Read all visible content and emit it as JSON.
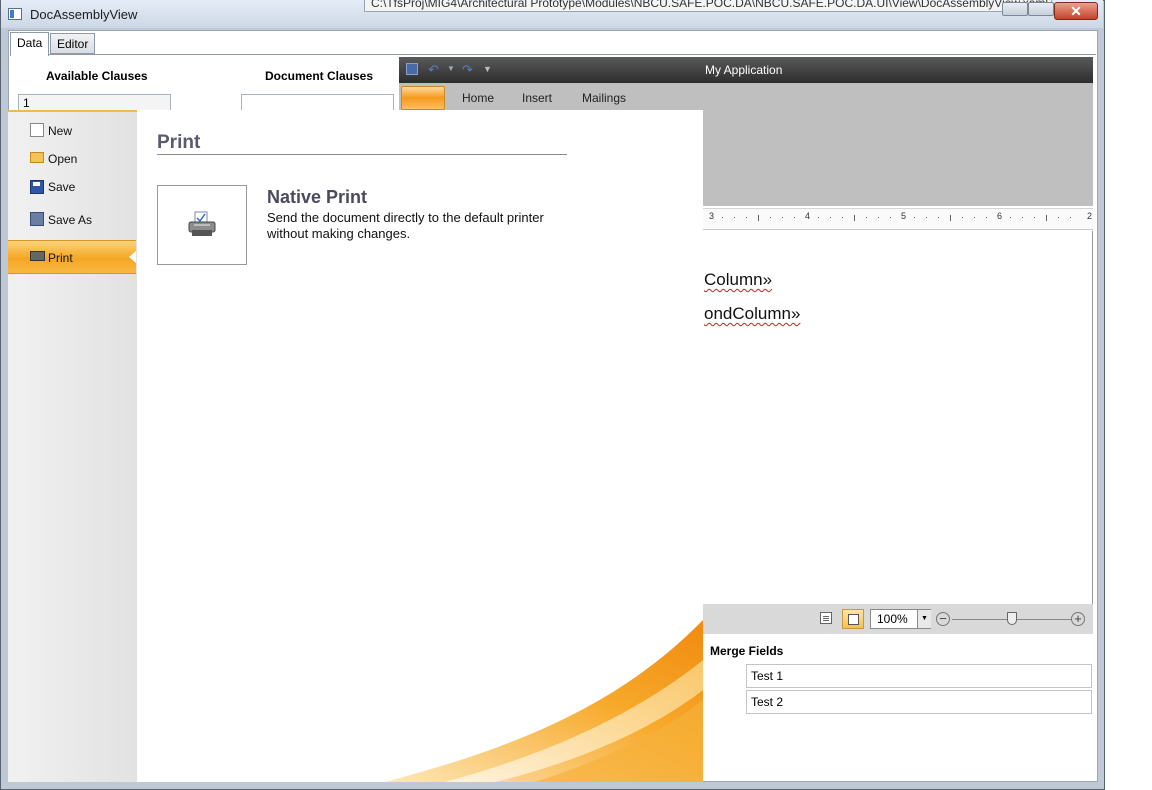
{
  "window": {
    "title": "DocAssemblyView",
    "tooltip_path": "C:\\TfsProj\\MIG4\\Architectural Prototype\\Modules\\NBCU.SAFE.POC.DA\\NBCU.SAFE.POC.DA.UI\\View\\DocAssemblyView.xaml.cs",
    "close_glyph": "✕"
  },
  "tabs": [
    {
      "label": "Data"
    },
    {
      "label": "Editor"
    }
  ],
  "clauses": {
    "available_header": "Available Clauses",
    "available_value": "1",
    "document_header": "Document Clauses",
    "document_value": ""
  },
  "editor": {
    "app_title": "My Application",
    "ribbon_tabs": [
      "Home",
      "Insert",
      "Mailings"
    ],
    "ruler_numbers": [
      "3",
      "4",
      "5",
      "6",
      "2"
    ],
    "document_lines": [
      "Column»",
      "ondColumn»"
    ],
    "zoom_value": "100%",
    "zoom_fraction": 0.5
  },
  "merge_fields": {
    "header": "Merge Fields",
    "items": [
      "Test 1",
      "Test 2"
    ]
  },
  "backstage": {
    "menu": [
      {
        "label": "New",
        "icon": "new-document-icon"
      },
      {
        "label": "Open",
        "icon": "open-folder-icon"
      },
      {
        "label": "Save",
        "icon": "save-disk-icon"
      },
      {
        "label": "Save As",
        "icon": "save-as-icon"
      },
      {
        "label": "Print",
        "icon": "printer-icon",
        "selected": true
      }
    ],
    "panel_title": "Print",
    "native_print": {
      "title": "Native Print",
      "description": "Send the document directly to the default printer without making changes."
    }
  },
  "colors": {
    "accent_orange": "#f5a623",
    "titlebar_dark": "#2d2d2d",
    "ribbon_gray": "#bfbfbf"
  }
}
